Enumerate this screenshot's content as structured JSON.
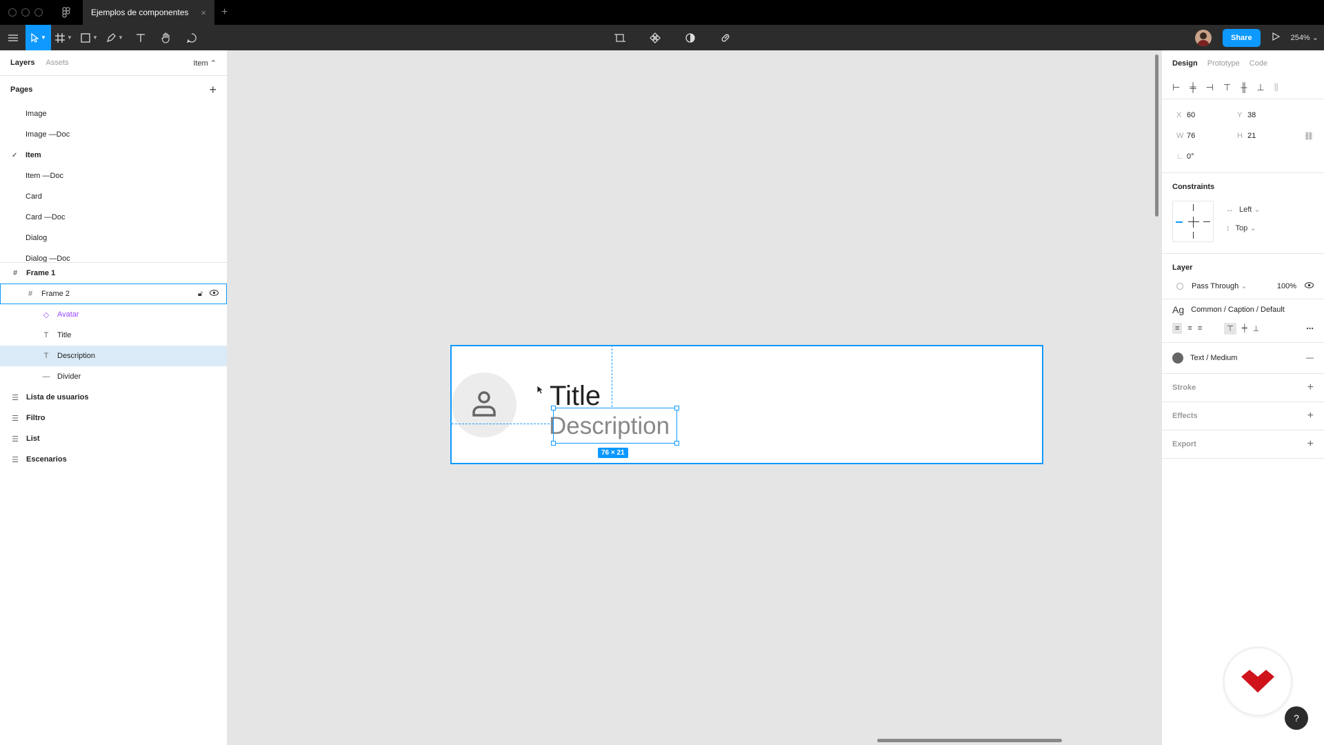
{
  "titlebar": {
    "tab_title": "Ejemplos de componentes",
    "close_glyph": "×",
    "new_tab_glyph": "+"
  },
  "toolbar": {
    "share_label": "Share",
    "zoom_label": "254%",
    "zoom_caret": "⌄"
  },
  "left_panel": {
    "tab_layers": "Layers",
    "tab_assets": "Assets",
    "page_switch": "Item ⌃",
    "pages_header": "Pages",
    "pages_add": "+",
    "pages": [
      {
        "label": "Image",
        "current": false
      },
      {
        "label": "Image —Doc",
        "current": false
      },
      {
        "label": "Item",
        "current": true
      },
      {
        "label": "Item —Doc",
        "current": false
      },
      {
        "label": "Card",
        "current": false
      },
      {
        "label": "Card —Doc",
        "current": false
      },
      {
        "label": "Dialog",
        "current": false
      },
      {
        "label": "Dialog —Doc",
        "current": false
      }
    ],
    "layers": {
      "frame1": "Frame 1",
      "frame2": "Frame 2",
      "avatar": "Avatar",
      "title": "Title",
      "description": "Description",
      "divider": "Divider",
      "lista": "Lista de usuarios",
      "filtro": "Filtro",
      "list": "List",
      "escenarios": "Escenarios"
    }
  },
  "canvas": {
    "title_text": "Title",
    "description_text": "Description",
    "size_badge": "76 × 21"
  },
  "right_panel": {
    "tab_design": "Design",
    "tab_prototype": "Prototype",
    "tab_code": "Code",
    "x_label": "X",
    "x_value": "60",
    "y_label": "Y",
    "y_value": "38",
    "w_label": "W",
    "w_value": "76",
    "h_label": "H",
    "h_value": "21",
    "rotation_value": "0°",
    "constraints_title": "Constraints",
    "constraint_h": "Left",
    "constraint_v": "Top",
    "layer_title": "Layer",
    "blend_mode": "Pass Through",
    "opacity": "100%",
    "text_style_ag": "Ag",
    "text_style_name": "Common / Caption / Default",
    "fill_name": "Text / Medium",
    "stroke_title": "Stroke",
    "effects_title": "Effects",
    "export_title": "Export"
  },
  "colors": {
    "accent": "#0d99ff",
    "toolbar_bg": "#2c2c2c",
    "canvas_bg": "#e5e5e5",
    "component_purple": "#9747ff",
    "logo_red": "#d0121b"
  },
  "help": {
    "glyph": "?"
  }
}
